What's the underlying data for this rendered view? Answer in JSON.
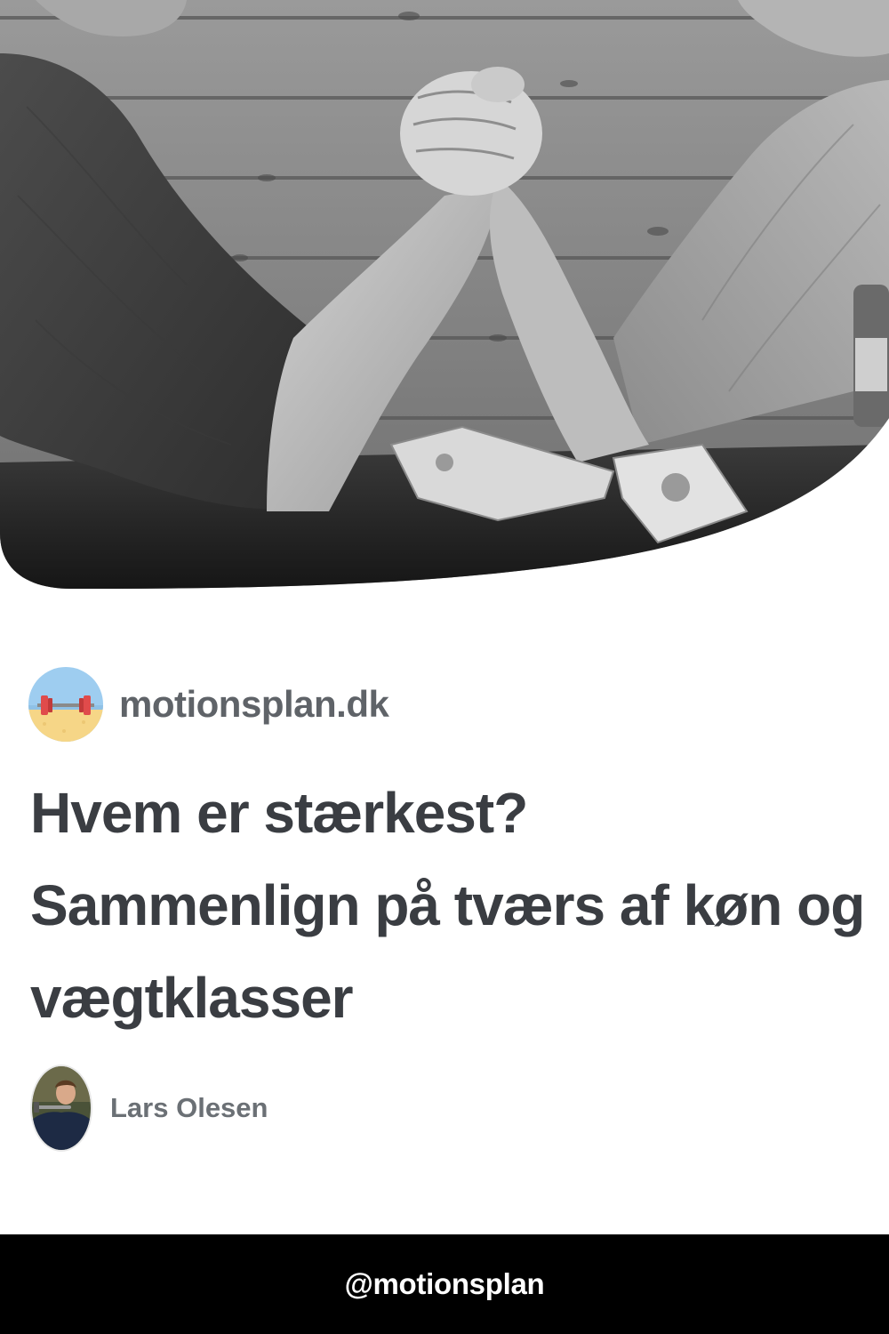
{
  "hero": {
    "image_icon": "arm-wrestling-photo"
  },
  "site": {
    "logo_icon": "barbell-icon",
    "name": "motionsplan.dk"
  },
  "article": {
    "title": "Hvem er stærkest? Sammenlign på tværs af køn og vægtklasser"
  },
  "author": {
    "avatar_icon": "author-avatar",
    "name": "Lars Olesen"
  },
  "footer": {
    "handle": "@motionsplan"
  },
  "colors": {
    "footer_bg": "#000000",
    "footer_text": "#ffffff",
    "title_text": "#3a3d42",
    "site_name_text": "#5f6368",
    "author_text": "#6b7075",
    "logo_sky": "#9ecdf0",
    "logo_sand": "#f6d687",
    "barbell_plate": "#e04b4b"
  }
}
